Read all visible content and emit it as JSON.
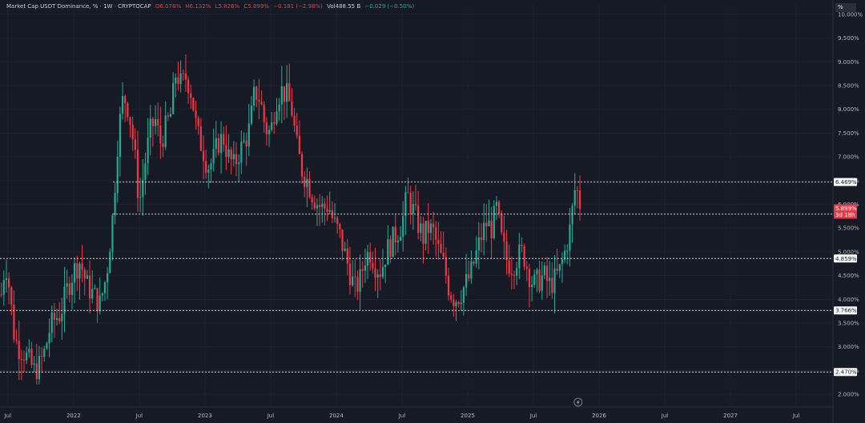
{
  "legend": {
    "title": "Market Cap USDT Dominance, % · 1W · CRYPTOCAP",
    "open": "O6.078%",
    "high": "H6.132%",
    "low": "L5.826%",
    "close": "C5.899%",
    "change": "−0.181 (−2.98%)",
    "vol": "Vol488.55 B",
    "vol_change": "−0.029 (−0.50%)"
  },
  "unit_label": "%",
  "colors": {
    "background": "#161a25",
    "up": "#22ab94",
    "down": "#f23645",
    "level_line": "#d1d4dc"
  },
  "chart_data": {
    "type": "candlestick",
    "title": "Market Cap USDT Dominance, % · 1W · CRYPTOCAP",
    "ylim": [
      1.75,
      10.2
    ],
    "y_ticks": [
      "2.000%",
      "2.500%",
      "3.000%",
      "3.500%",
      "4.000%",
      "4.500%",
      "5.000%",
      "5.500%",
      "6.000%",
      "6.500%",
      "7.000%",
      "7.500%",
      "8.000%",
      "8.500%",
      "9.000%",
      "9.500%",
      "10.000%"
    ],
    "x_ticks": [
      {
        "label": "Jul",
        "t": 2021.5
      },
      {
        "label": "2022",
        "t": 2022.0
      },
      {
        "label": "Jul",
        "t": 2022.5
      },
      {
        "label": "2023",
        "t": 2023.0
      },
      {
        "label": "Jul",
        "t": 2023.5
      },
      {
        "label": "2024",
        "t": 2024.0
      },
      {
        "label": "Jul",
        "t": 2024.5
      },
      {
        "label": "2025",
        "t": 2025.0
      },
      {
        "label": "Jul",
        "t": 2025.5
      },
      {
        "label": "2026",
        "t": 2026.0
      },
      {
        "label": "Jul",
        "t": 2026.5
      },
      {
        "label": "2027",
        "t": 2027.0
      },
      {
        "label": "Jul",
        "t": 2027.5
      }
    ],
    "x_range": [
      2021.44,
      2027.78
    ],
    "price_path": [
      [
        2021.45,
        4.1
      ],
      [
        2021.48,
        4.8
      ],
      [
        2021.5,
        4.5
      ],
      [
        2021.55,
        3.2
      ],
      [
        2021.58,
        3.0
      ],
      [
        2021.62,
        2.9
      ],
      [
        2021.66,
        2.7
      ],
      [
        2021.7,
        2.5
      ],
      [
        2021.74,
        2.6
      ],
      [
        2021.78,
        2.9
      ],
      [
        2021.82,
        3.4
      ],
      [
        2021.86,
        3.6
      ],
      [
        2021.9,
        3.7
      ],
      [
        2021.95,
        4.2
      ],
      [
        2022.0,
        4.6
      ],
      [
        2022.05,
        4.8
      ],
      [
        2022.1,
        4.3
      ],
      [
        2022.15,
        4.1
      ],
      [
        2022.2,
        3.9
      ],
      [
        2022.25,
        4.5
      ],
      [
        2022.3,
        5.8
      ],
      [
        2022.34,
        7.5
      ],
      [
        2022.38,
        8.3
      ],
      [
        2022.42,
        8.0
      ],
      [
        2022.46,
        7.2
      ],
      [
        2022.5,
        6.0
      ],
      [
        2022.54,
        6.8
      ],
      [
        2022.58,
        7.5
      ],
      [
        2022.62,
        7.8
      ],
      [
        2022.66,
        7.3
      ],
      [
        2022.7,
        7.6
      ],
      [
        2022.74,
        7.9
      ],
      [
        2022.78,
        8.8
      ],
      [
        2022.82,
        8.5
      ],
      [
        2022.86,
        8.7
      ],
      [
        2022.9,
        8.3
      ],
      [
        2022.94,
        7.5
      ],
      [
        2022.98,
        7.2
      ],
      [
        2023.02,
        6.8
      ],
      [
        2023.06,
        6.9
      ],
      [
        2023.1,
        7.3
      ],
      [
        2023.14,
        7.4
      ],
      [
        2023.18,
        7.0
      ],
      [
        2023.22,
        6.8
      ],
      [
        2023.26,
        7.1
      ],
      [
        2023.3,
        7.3
      ],
      [
        2023.34,
        7.6
      ],
      [
        2023.38,
        8.4
      ],
      [
        2023.42,
        8.2
      ],
      [
        2023.46,
        7.6
      ],
      [
        2023.5,
        7.5
      ],
      [
        2023.54,
        8.2
      ],
      [
        2023.58,
        8.4
      ],
      [
        2023.62,
        8.3
      ],
      [
        2023.66,
        8.0
      ],
      [
        2023.7,
        7.2
      ],
      [
        2023.74,
        6.7
      ],
      [
        2023.78,
        6.5
      ],
      [
        2023.82,
        6.2
      ],
      [
        2023.86,
        6.0
      ],
      [
        2023.9,
        5.9
      ],
      [
        2023.94,
        6.0
      ],
      [
        2023.98,
        5.6
      ],
      [
        2024.02,
        5.4
      ],
      [
        2024.06,
        5.0
      ],
      [
        2024.1,
        4.6
      ],
      [
        2024.14,
        4.2
      ],
      [
        2024.18,
        4.4
      ],
      [
        2024.22,
        4.9
      ],
      [
        2024.26,
        5.0
      ],
      [
        2024.3,
        4.7
      ],
      [
        2024.34,
        4.6
      ],
      [
        2024.38,
        5.0
      ],
      [
        2024.42,
        5.2
      ],
      [
        2024.46,
        5.4
      ],
      [
        2024.5,
        5.6
      ],
      [
        2024.54,
        6.2
      ],
      [
        2024.58,
        5.9
      ],
      [
        2024.62,
        5.6
      ],
      [
        2024.66,
        5.3
      ],
      [
        2024.7,
        5.5
      ],
      [
        2024.74,
        5.4
      ],
      [
        2024.78,
        5.0
      ],
      [
        2024.82,
        4.7
      ],
      [
        2024.86,
        4.2
      ],
      [
        2024.9,
        4.0
      ],
      [
        2024.94,
        4.1
      ],
      [
        2024.98,
        4.3
      ],
      [
        2025.02,
        4.5
      ],
      [
        2025.06,
        4.9
      ],
      [
        2025.1,
        5.3
      ],
      [
        2025.14,
        5.6
      ],
      [
        2025.18,
        5.5
      ],
      [
        2025.22,
        5.9
      ],
      [
        2025.26,
        5.2
      ],
      [
        2025.3,
        4.8
      ],
      [
        2025.34,
        4.7
      ],
      [
        2025.38,
        4.9
      ],
      [
        2025.42,
        5.0
      ],
      [
        2025.46,
        4.6
      ],
      [
        2025.5,
        4.3
      ],
      [
        2025.54,
        4.4
      ],
      [
        2025.58,
        4.5
      ],
      [
        2025.62,
        4.3
      ],
      [
        2025.66,
        4.4
      ],
      [
        2025.7,
        4.6
      ],
      [
        2025.74,
        5.0
      ],
      [
        2025.78,
        5.5
      ],
      [
        2025.82,
        6.4
      ],
      [
        2025.84,
        6.2
      ],
      [
        2025.86,
        5.9
      ]
    ],
    "levels": [
      {
        "value": 6.469,
        "label": "6.469%"
      },
      {
        "value": 5.793,
        "label": "5.793%"
      },
      {
        "value": 4.859,
        "label": "4.859%"
      },
      {
        "value": 3.766,
        "label": "3.766%"
      },
      {
        "value": 2.47,
        "label": "2.470%"
      }
    ],
    "current_price": {
      "value": 5.899,
      "label": "5.899%",
      "countdown": "3d 18h"
    }
  }
}
